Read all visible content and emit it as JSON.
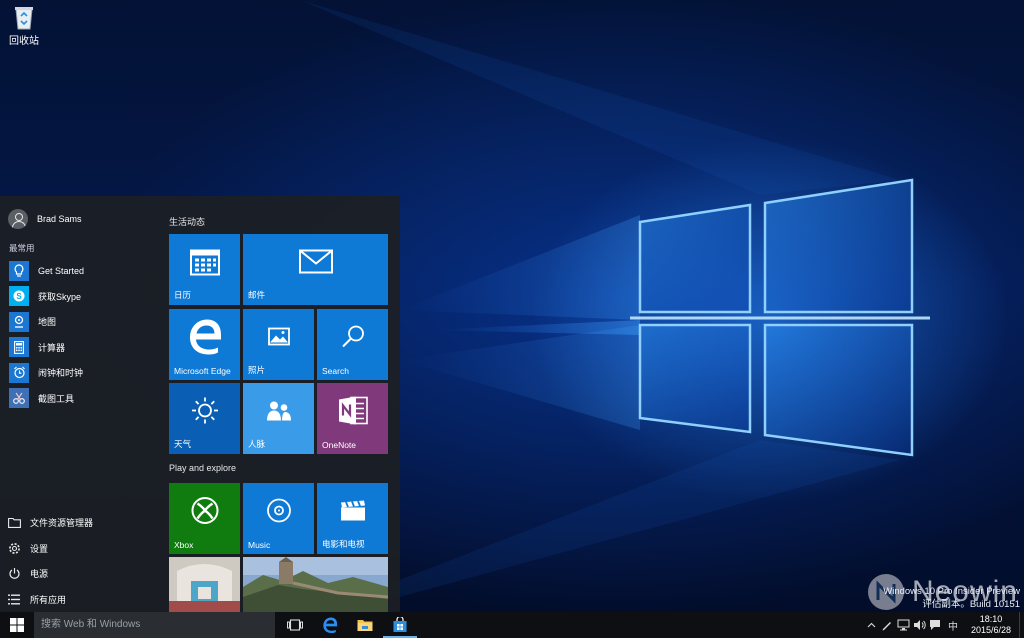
{
  "desktop": {
    "recycle_bin_label": "回收站",
    "watermark": "Neowin",
    "build_line1": "Windows 10 Pro Insider Preview",
    "build_line2": "评估副本。Build 10151"
  },
  "start_menu": {
    "user_name": "Brad Sams",
    "most_used_header": "最常用",
    "most_used": [
      {
        "label": "Get Started",
        "icon": "lightbulb-icon"
      },
      {
        "label": "获取Skype",
        "icon": "skype-icon"
      },
      {
        "label": "地图",
        "icon": "maps-icon"
      },
      {
        "label": "计算器",
        "icon": "calculator-icon"
      },
      {
        "label": "闹钟和时钟",
        "icon": "alarm-icon"
      },
      {
        "label": "截图工具",
        "icon": "snipping-tool-icon"
      }
    ],
    "system_items": [
      {
        "label": "文件资源管理器",
        "icon": "file-explorer-icon"
      },
      {
        "label": "设置",
        "icon": "gear-icon"
      },
      {
        "label": "电源",
        "icon": "power-icon"
      },
      {
        "label": "所有应用",
        "icon": "all-apps-icon"
      }
    ],
    "groups": {
      "life": "生活动态",
      "play": "Play and explore"
    },
    "tiles": {
      "calendar": "日历",
      "mail": "邮件",
      "edge": "Microsoft Edge",
      "photos": "照片",
      "search": "Search",
      "weather": "天气",
      "people": "人脉",
      "onenote": "OneNote",
      "xbox": "Xbox",
      "music": "Music",
      "movies": "电影和电视"
    }
  },
  "taskbar": {
    "search_placeholder": "搜索 Web 和 Windows",
    "ime": "中",
    "time": "18:10",
    "date": "2015/6/28"
  },
  "colors": {
    "tile_blue": "#0e7ad6",
    "tile_dark_blue": "#0a5fb4",
    "tile_light_blue": "#3a9be8",
    "xbox_green": "#107c10",
    "onenote_purple": "#80397b",
    "taskbar": "#0d0f13",
    "start_menu": "#1c1f24"
  }
}
